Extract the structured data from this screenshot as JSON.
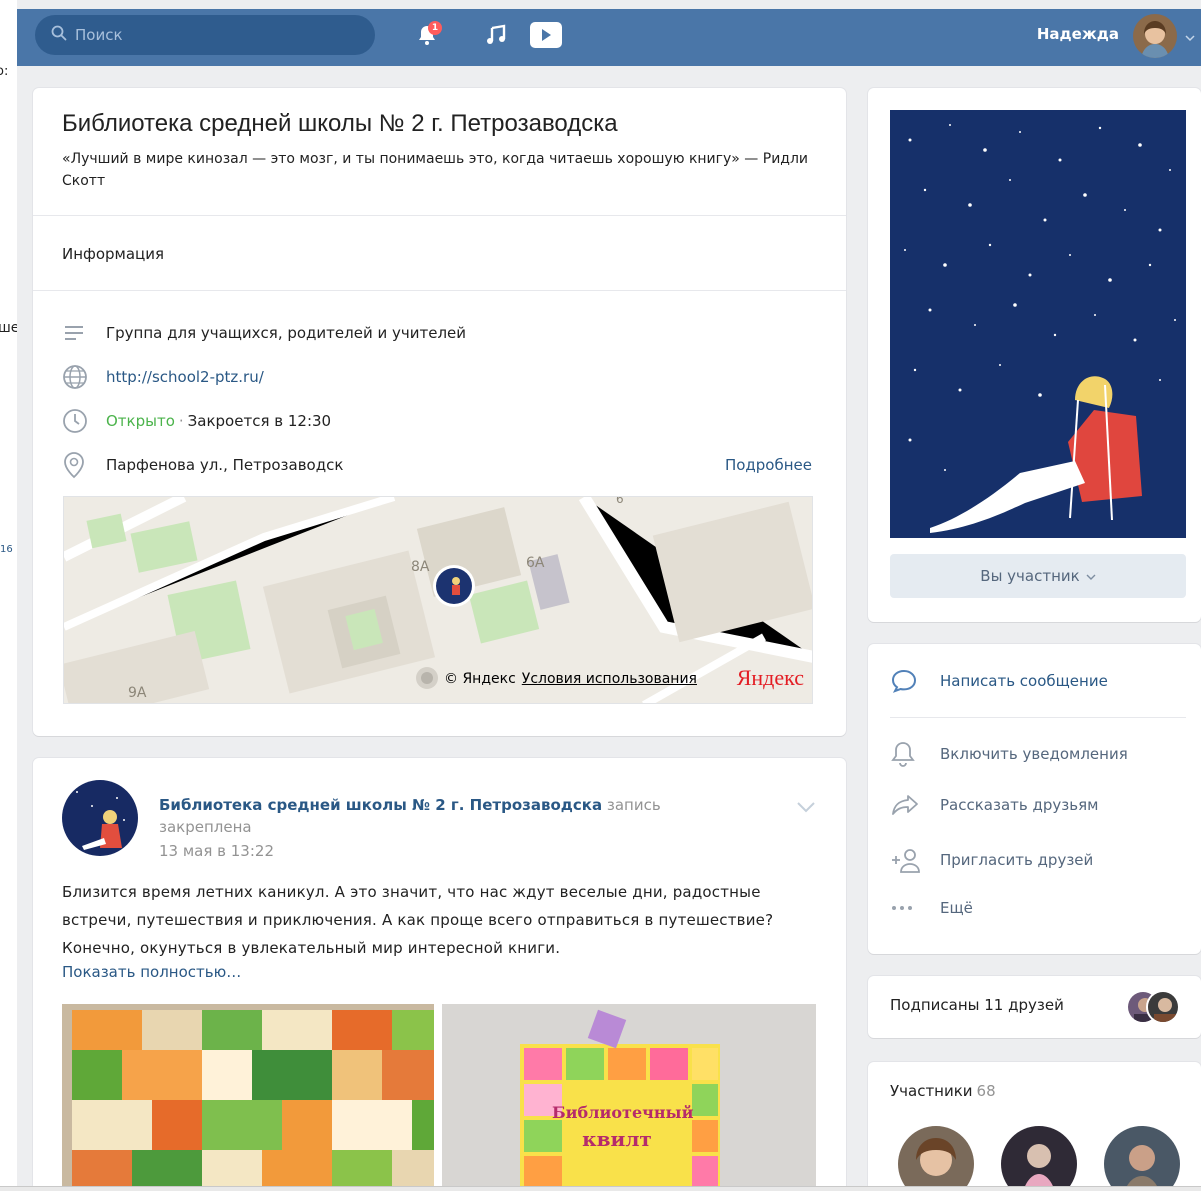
{
  "left_strip": {
    "text1": "о:",
    "text2": "ше",
    "text3": "16"
  },
  "header": {
    "search_placeholder": "Поиск",
    "notifications_count": "1",
    "user_name": "Надежда",
    "accent_color": "#4a76a8"
  },
  "group": {
    "title": "Библиотека средней школы № 2 г. Петрозаводска",
    "status": "«Лучший в мире кинозал — это мозг, и ты понимаешь это, когда читаешь хорошую книгу» — Ридли Скотт",
    "info_tab": "Информация",
    "description": "Группа для учащихся, родителей и учителей",
    "website": "http://school2-ptz.ru/",
    "open_status": "Открыто",
    "dot": "·",
    "hours": "Закроется в 12:30",
    "address": "Парфенова ул., Петрозаводск",
    "more_link": "Подробнее"
  },
  "map": {
    "labels": [
      "8А",
      "6А",
      "9А",
      "6"
    ],
    "copyright": "© Яндекс",
    "terms": "Условия использования",
    "logo": "Яндекс"
  },
  "post": {
    "author": "Библиотека средней школы № 2 г. Петрозаводска",
    "pinned_note": "запись закреплена",
    "date": "13 мая в 13:22",
    "text": "Близится время летних каникул. А это значит, что нас ждут веселые дни, радостные встречи, путешествия и приключения. А как проще всего отправиться в путешествие? Конечно, окунуться в увлекательный мир интересной книги.",
    "show_more": "Показать полностью…",
    "image2_caption_line1": "Библиотечный",
    "image2_caption_line2": "квилт"
  },
  "sidebar": {
    "member_button": "Вы участник",
    "actions": {
      "message": "Написать сообщение",
      "notifications": "Включить уведомления",
      "share": "Рассказать друзьям",
      "invite": "Пригласить друзей",
      "more": "Ещё"
    },
    "friends_subscribed": "Подписаны 11 друзей",
    "members_title": "Участники",
    "members_count": "68"
  }
}
